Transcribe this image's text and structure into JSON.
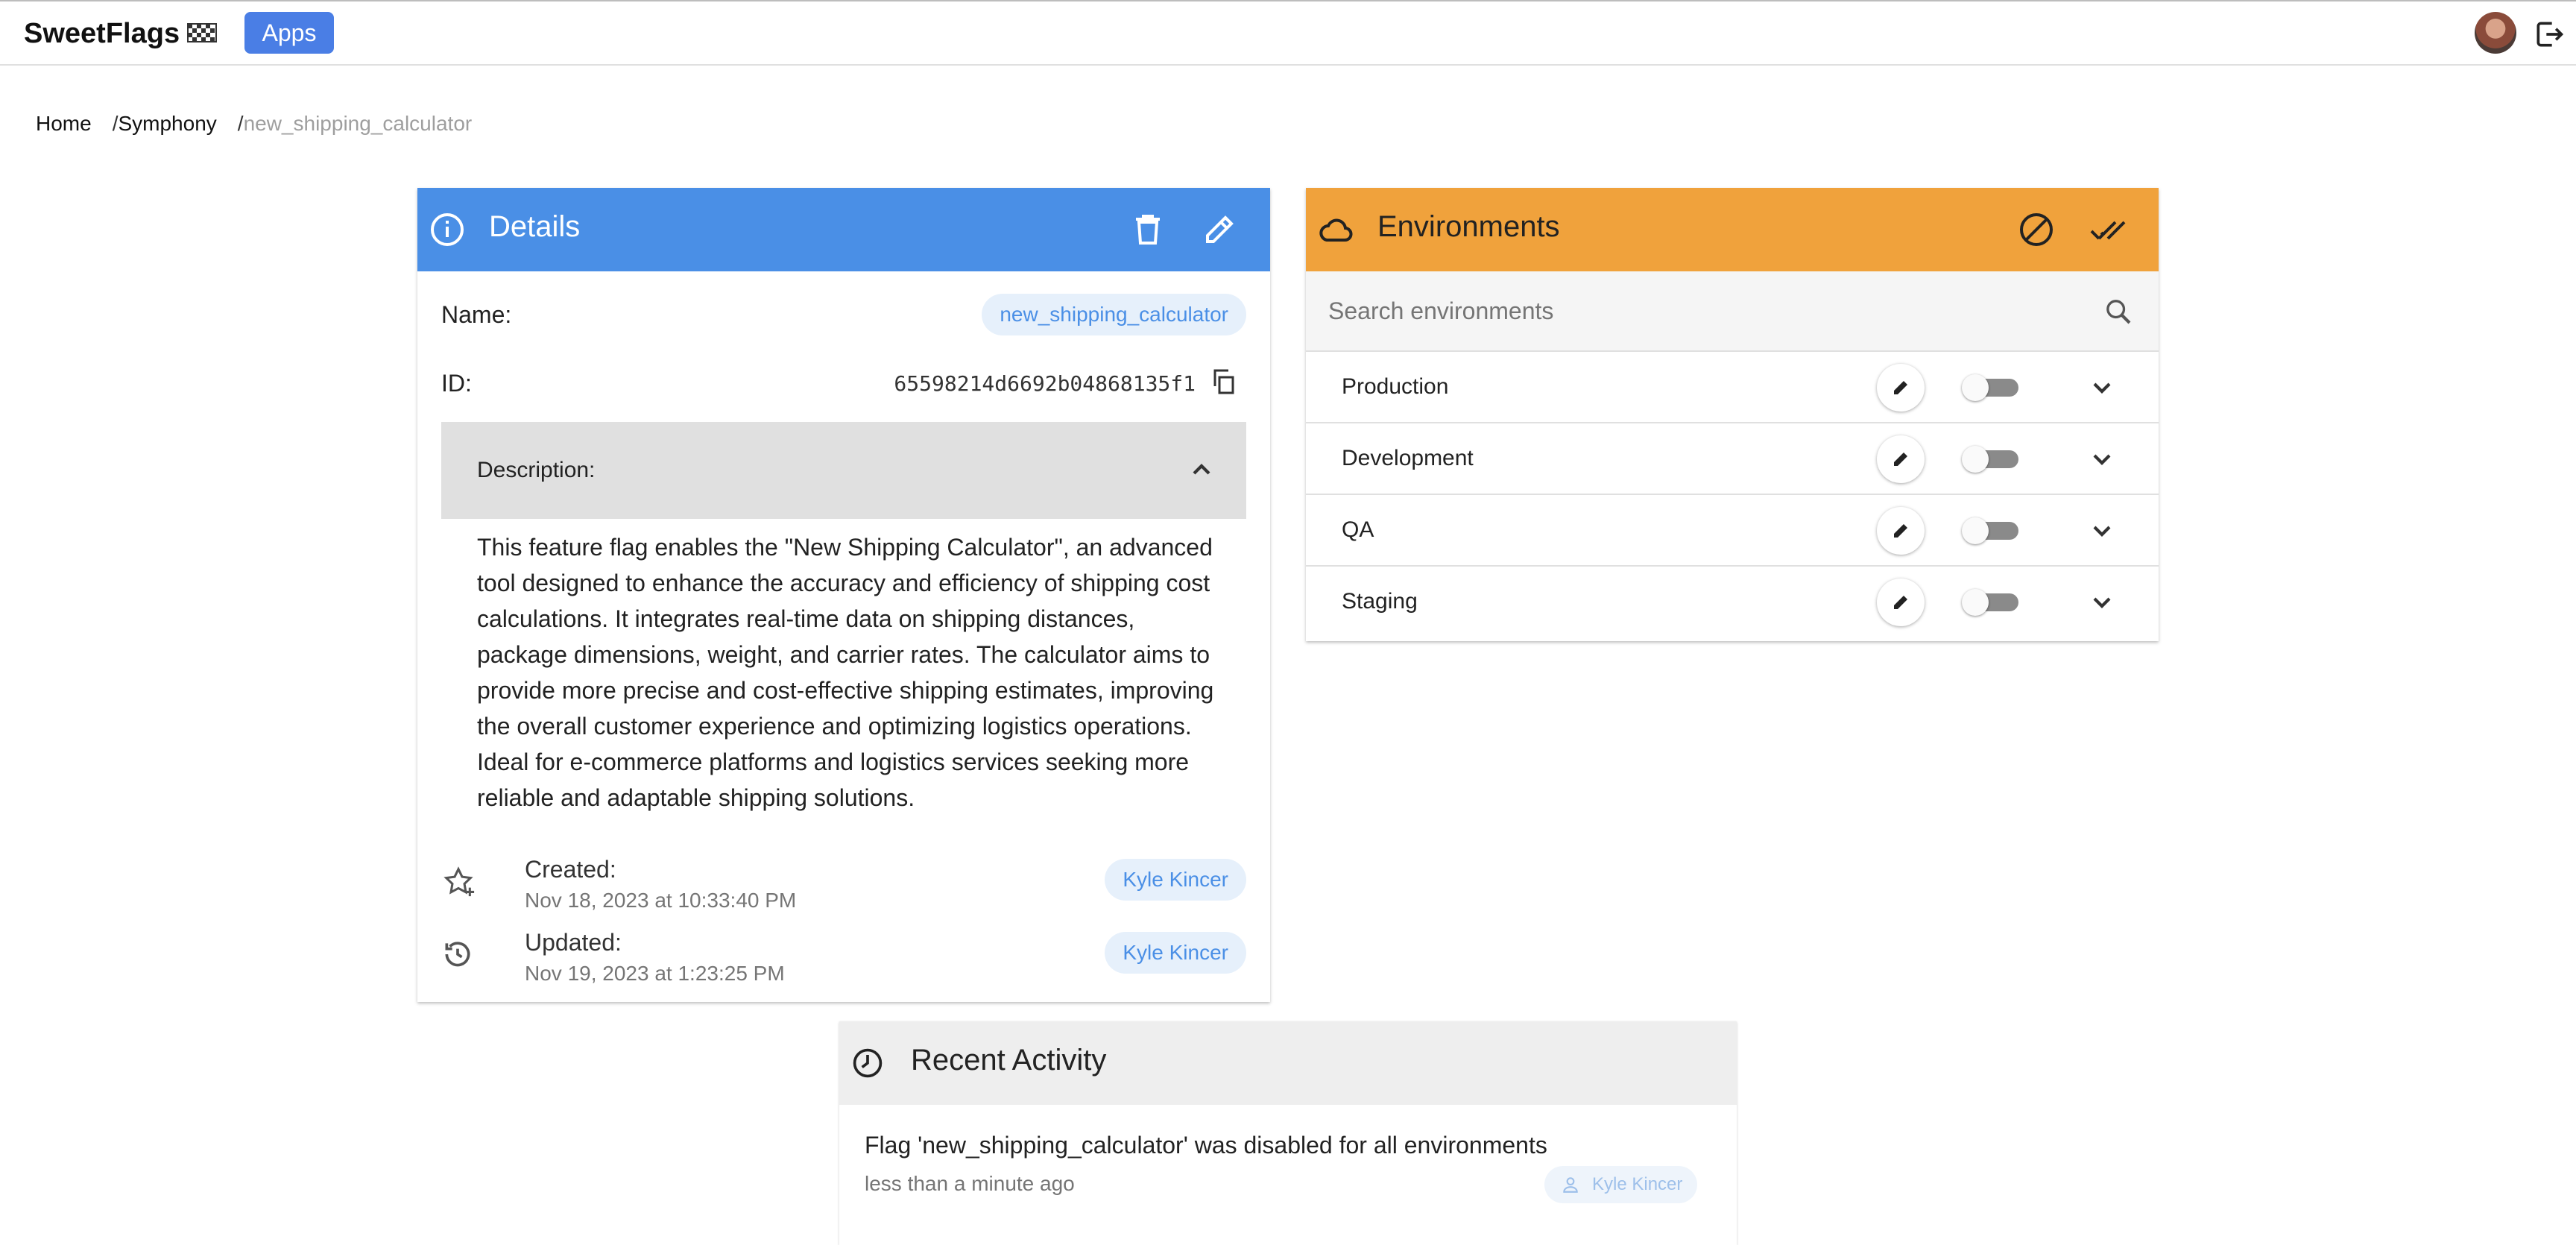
{
  "appbar": {
    "brand": "SweetFlags",
    "brand_icon": "checkered-flag-icon",
    "apps_label": "Apps",
    "avatar_icon": "user-avatar",
    "logout_icon": "logout-icon"
  },
  "breadcrumb": {
    "items": [
      "Home",
      "Symphony",
      "new_shipping_calculator"
    ],
    "separator": "/"
  },
  "details": {
    "title": "Details",
    "header_color": "#4a8fe6",
    "icons": [
      "info-icon",
      "delete-icon",
      "edit-icon"
    ],
    "name_label": "Name:",
    "name_value": "new_shipping_calculator",
    "id_label": "ID:",
    "id_value": "65598214d6692b04868135f1",
    "description_label": "Description:",
    "description": "This feature flag enables the \"New Shipping Calculator\", an advanced tool designed to enhance the accuracy and efficiency of shipping cost calculations. It integrates real-time data on shipping distances, package dimensions, weight, and carrier rates. The calculator aims to provide more precise and cost-effective shipping estimates, improving the overall customer experience and optimizing logistics operations. Ideal for e-commerce platforms and logistics services seeking more reliable and adaptable shipping solutions.",
    "created_label": "Created:",
    "created_date": "Nov 18, 2023 at 10:33:40 PM",
    "created_by": "Kyle Kincer",
    "updated_label": "Updated:",
    "updated_date": "Nov 19, 2023 at 1:23:25 PM",
    "updated_by": "Kyle Kincer"
  },
  "environments": {
    "title": "Environments",
    "header_color": "#f0a23c",
    "search_placeholder": "Search environments",
    "items": [
      {
        "name": "Production",
        "enabled": false
      },
      {
        "name": "Development",
        "enabled": false
      },
      {
        "name": "QA",
        "enabled": false
      },
      {
        "name": "Staging",
        "enabled": false
      }
    ]
  },
  "activity": {
    "title": "Recent Activity",
    "items": [
      {
        "text": "Flag 'new_shipping_calculator' was disabled for all environments",
        "time": "less than a minute ago",
        "user": "Kyle Kincer"
      }
    ]
  }
}
